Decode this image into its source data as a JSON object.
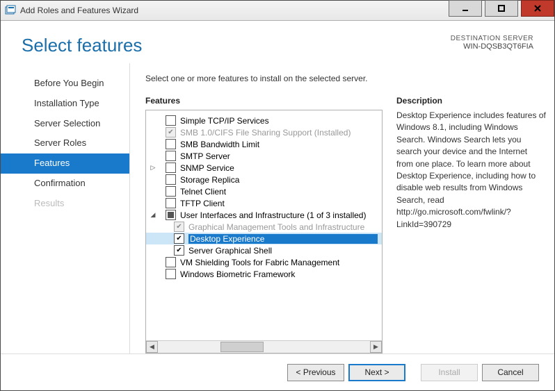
{
  "window": {
    "title": "Add Roles and Features Wizard"
  },
  "header": {
    "title": "Select features",
    "destination_label": "DESTINATION SERVER",
    "destination_server": "WIN-DQSB3QT6FIA"
  },
  "nav": {
    "items": [
      {
        "label": "Before You Begin",
        "state": "normal"
      },
      {
        "label": "Installation Type",
        "state": "normal"
      },
      {
        "label": "Server Selection",
        "state": "normal"
      },
      {
        "label": "Server Roles",
        "state": "normal"
      },
      {
        "label": "Features",
        "state": "selected"
      },
      {
        "label": "Confirmation",
        "state": "normal"
      },
      {
        "label": "Results",
        "state": "disabled"
      }
    ]
  },
  "instruction": "Select one or more features to install on the selected server.",
  "features": {
    "heading": "Features",
    "items": [
      {
        "label": "Simple TCP/IP Services",
        "checked": false,
        "indent": 1,
        "expander": ""
      },
      {
        "label": "SMB 1.0/CIFS File Sharing Support (Installed)",
        "checked": true,
        "disabled": true,
        "indent": 1,
        "expander": ""
      },
      {
        "label": "SMB Bandwidth Limit",
        "checked": false,
        "indent": 1,
        "expander": ""
      },
      {
        "label": "SMTP Server",
        "checked": false,
        "indent": 1,
        "expander": ""
      },
      {
        "label": "SNMP Service",
        "checked": false,
        "indent": 1,
        "expander": "▷"
      },
      {
        "label": "Storage Replica",
        "checked": false,
        "indent": 1,
        "expander": ""
      },
      {
        "label": "Telnet Client",
        "checked": false,
        "indent": 1,
        "expander": ""
      },
      {
        "label": "TFTP Client",
        "checked": false,
        "indent": 1,
        "expander": ""
      },
      {
        "label": "User Interfaces and Infrastructure (1 of 3 installed)",
        "mixed": true,
        "indent": 1,
        "expander": "◢"
      },
      {
        "label": "Graphical Management Tools and Infrastructure",
        "checked": true,
        "disabled": true,
        "indent": 2,
        "expander": ""
      },
      {
        "label": "Desktop Experience",
        "checked": true,
        "indent": 2,
        "expander": "",
        "selected": true
      },
      {
        "label": "Server Graphical Shell",
        "checked": true,
        "indent": 2,
        "expander": ""
      },
      {
        "label": "VM Shielding Tools for Fabric Management",
        "checked": false,
        "indent": 1,
        "expander": ""
      },
      {
        "label": "Windows Biometric Framework",
        "checked": false,
        "indent": 1,
        "expander": ""
      }
    ]
  },
  "description": {
    "heading": "Description",
    "text": "Desktop Experience includes features of Windows 8.1, including Windows Search. Windows Search lets you search your device and the Internet from one place. To learn more about Desktop Experience, including how to disable web results from Windows Search, read http://go.microsoft.com/fwlink/?LinkId=390729"
  },
  "footer": {
    "previous": "< Previous",
    "next": "Next >",
    "install": "Install",
    "cancel": "Cancel"
  }
}
